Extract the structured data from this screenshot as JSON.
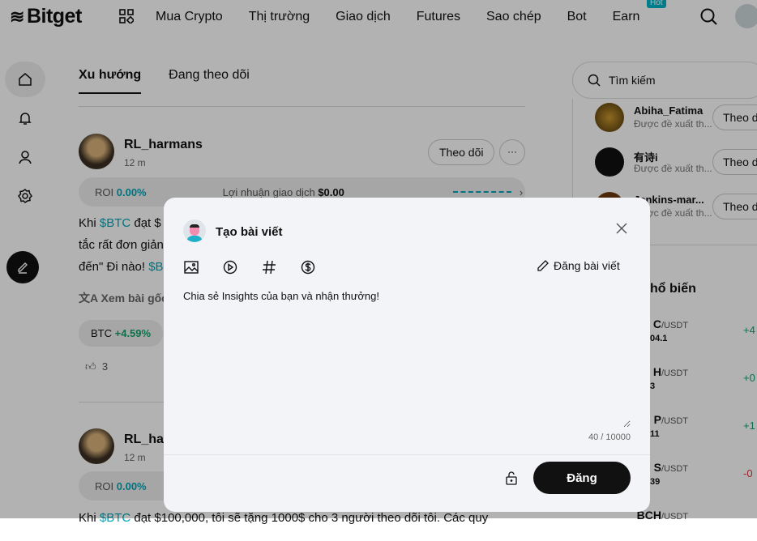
{
  "header": {
    "logo": "Bitget",
    "nav": [
      "Mua Crypto",
      "Thị trường",
      "Giao dịch",
      "Futures",
      "Sao chép",
      "Bot",
      "Earn"
    ],
    "hot_badge": "Hot"
  },
  "tabs": [
    "Xu hướng",
    "Đang theo dõi"
  ],
  "posts": [
    {
      "user": "RL_harmans",
      "time": "12 m",
      "follow": "Theo dõi",
      "more": "···",
      "roi_label": "ROI",
      "roi": "0.00%",
      "profit_label": "Lợi nhuận giao dịch",
      "profit": "$0.00",
      "lines": [
        [
          "Khi ",
          "$BTC",
          " đạt $"
        ],
        [
          "tắc rất đơn giản",
          "",
          ""
        ],
        [
          "đến\" Đi nào! ",
          "$B",
          ""
        ]
      ],
      "translate": "Xem bài gốc",
      "coin": "BTC",
      "coin_change": "+4.59%",
      "likes": "3"
    },
    {
      "user": "RL_harmans",
      "time": "12 m",
      "roi_label": "ROI",
      "roi": "0.00%",
      "line": [
        "Khi ",
        "$BTC",
        " đạt $100,000, tôi sẽ tặng 1000$ cho 3 người theo dõi tôi. Các quy"
      ]
    }
  ],
  "right": {
    "search_placeholder": "Tìm kiếm",
    "suggestions": [
      {
        "name": "Abiha_Fatima",
        "desc": "Được đề xuất th...",
        "btn": "Theo dõi"
      },
      {
        "name": "有诗i",
        "desc": "Được đề xuất th...",
        "btn": "Theo dõi"
      },
      {
        "name": "Jenkins-mar...",
        "desc": "Được đề xuất th...",
        "btn": "Theo dõi"
      }
    ],
    "popular_title": "hổ biến",
    "markets": [
      {
        "sym": "C",
        "quote": "/USDT",
        "price": "04.1",
        "change": "+4"
      },
      {
        "sym": "H",
        "quote": "/USDT",
        "price": "3",
        "change": "+0"
      },
      {
        "sym": "P",
        "quote": "/USDT",
        "price": "11",
        "change": "+1"
      },
      {
        "sym": "S",
        "quote": "/USDT",
        "price": "39",
        "change": "-0"
      },
      {
        "sym": "BCH",
        "quote": "/USDT",
        "price": "",
        "change": ""
      }
    ]
  },
  "modal": {
    "title": "Tạo bài viết",
    "publish_article": "Đăng bài viết",
    "placeholder": "Chia sẻ Insights của bạn và nhận thưởng!",
    "count": "40 / 10000",
    "submit": "Đăng"
  }
}
